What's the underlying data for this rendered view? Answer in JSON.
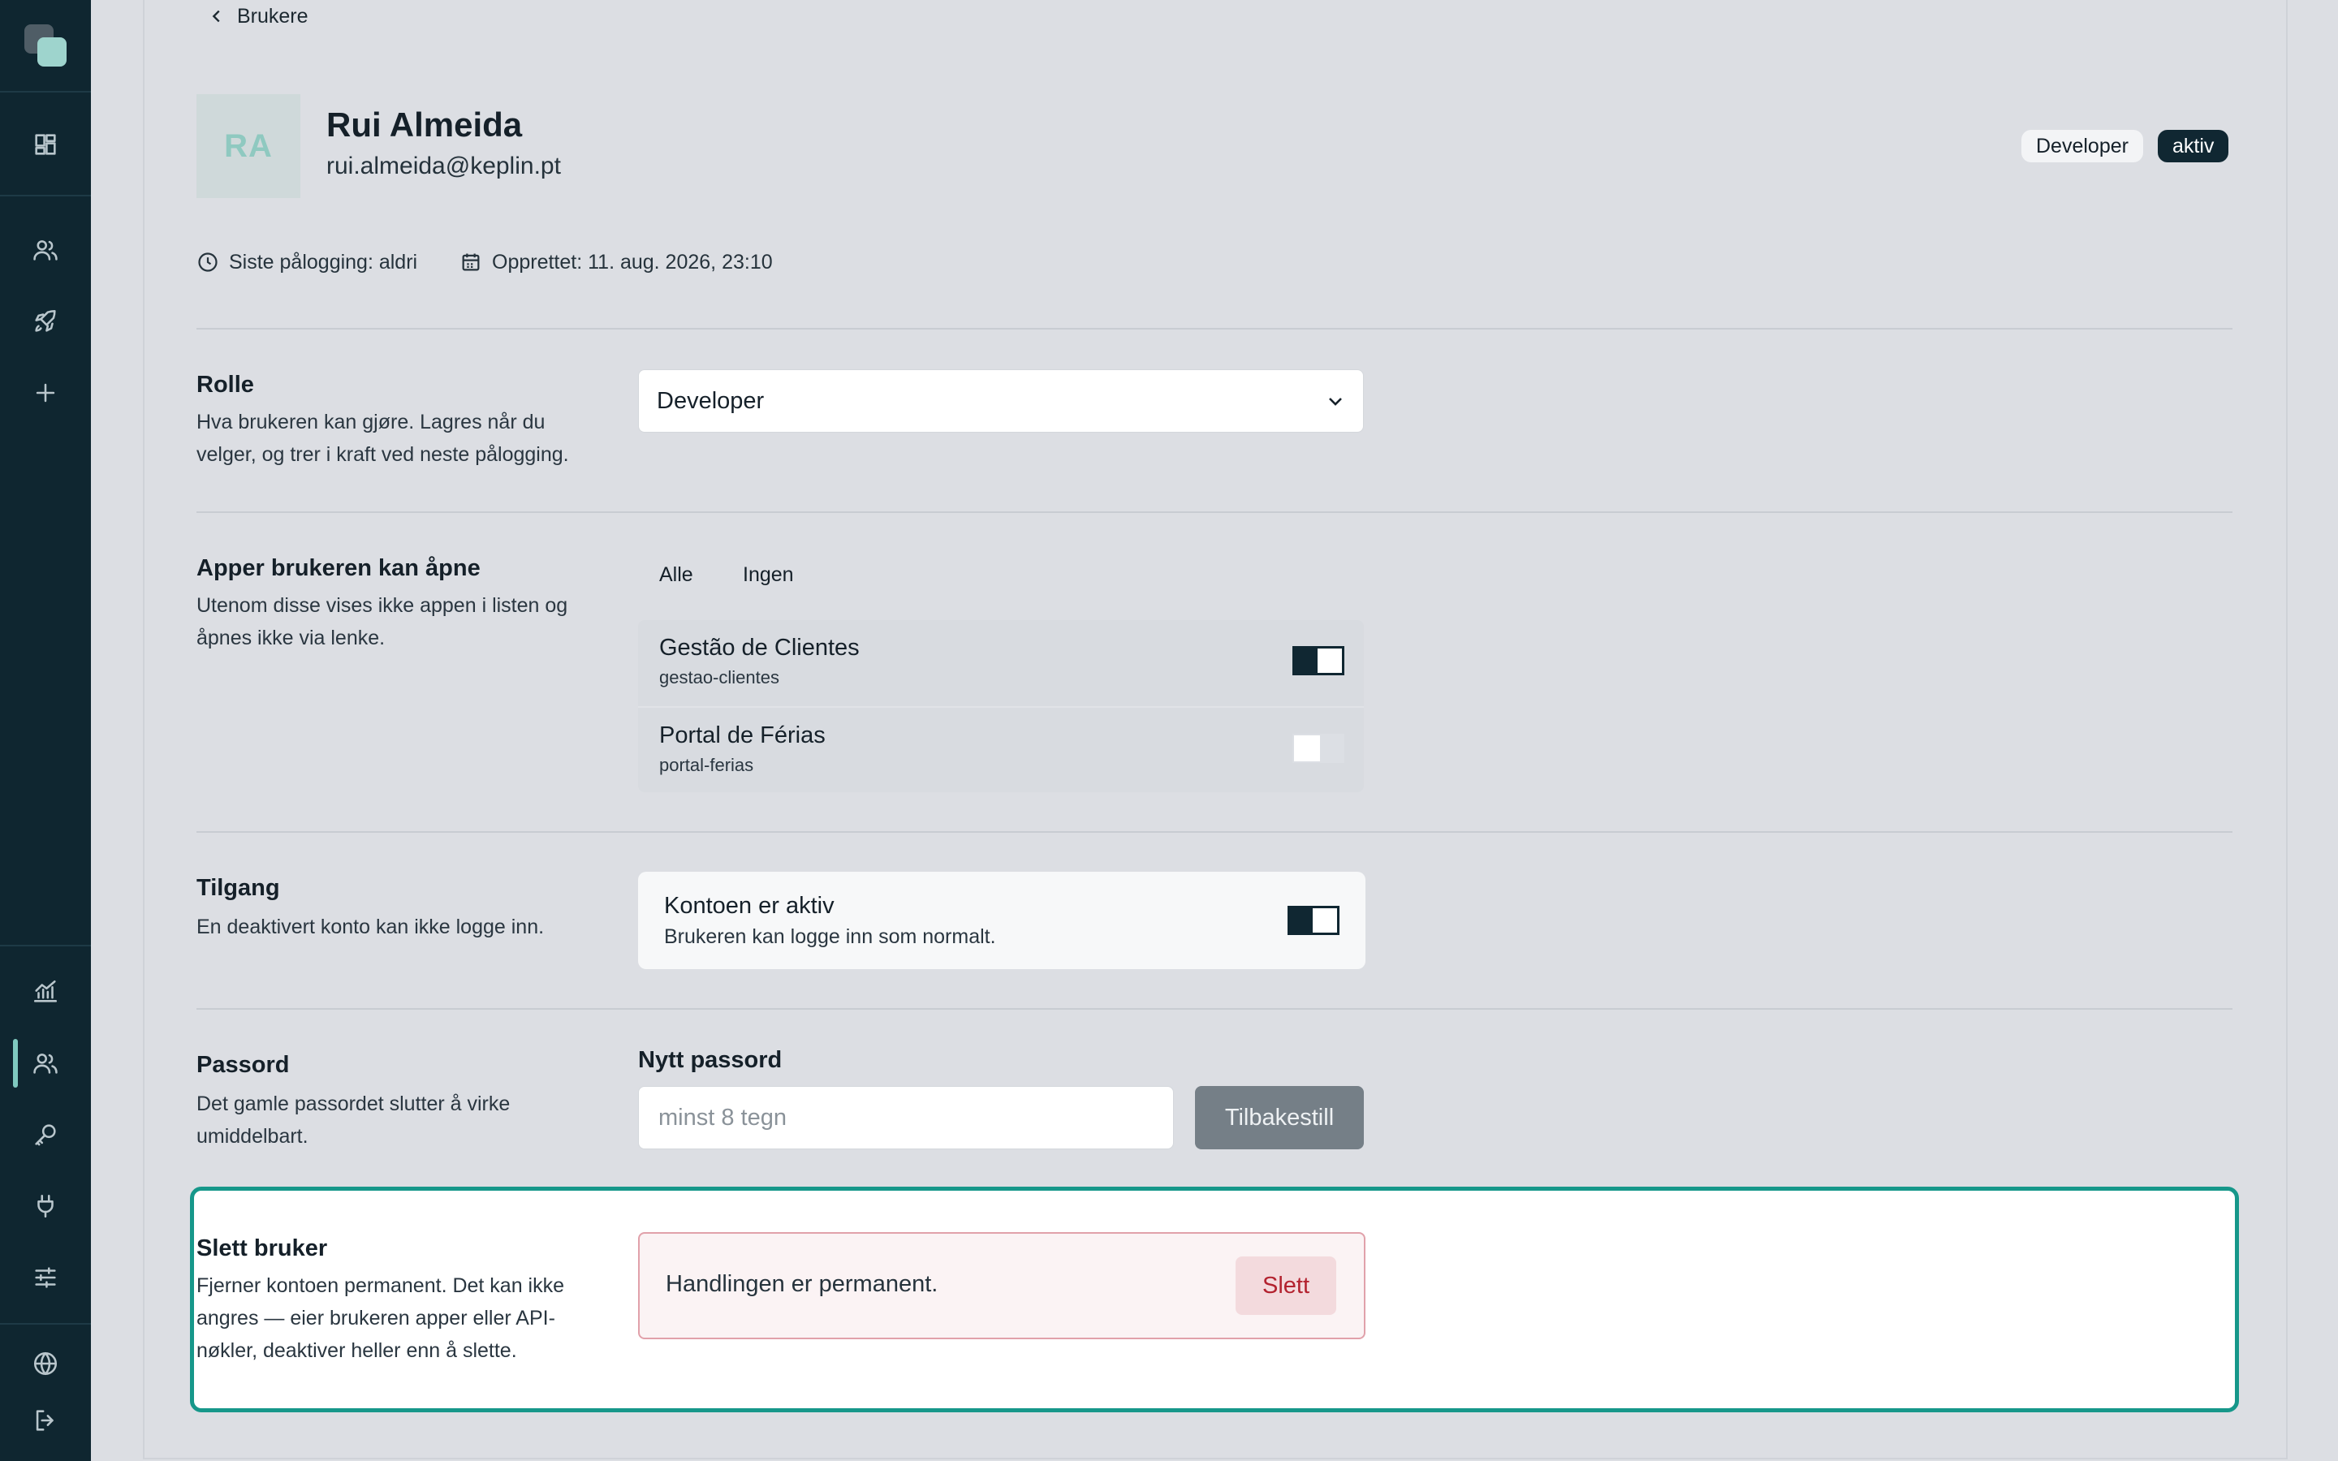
{
  "nav": {
    "back_label": "Brukere"
  },
  "user": {
    "initials": "RA",
    "name": "Rui Almeida",
    "email": "rui.almeida@keplin.pt",
    "role_badge": "Developer",
    "status_badge": "aktiv",
    "last_login": "Siste pålogging: aldri",
    "created": "Opprettet: 11. aug. 2026, 23:10"
  },
  "role_section": {
    "title": "Rolle",
    "description": "Hva brukeren kan gjøre. Lagres når du velger, og trer i kraft ved neste pålogging.",
    "selected": "Developer"
  },
  "apps_section": {
    "title": "Apper brukeren kan åpne",
    "description": "Utenom disse vises ikke appen i listen og åpnes ikke via lenke.",
    "all_label": "Alle",
    "none_label": "Ingen",
    "apps": [
      {
        "name": "Gestão de Clientes",
        "slug": "gestao-clientes",
        "enabled": true
      },
      {
        "name": "Portal de Férias",
        "slug": "portal-ferias",
        "enabled": false
      }
    ]
  },
  "access_section": {
    "title": "Tilgang",
    "description": "En deaktivert konto kan ikke logge inn.",
    "card_title": "Kontoen er aktiv",
    "card_subtitle": "Brukeren kan logge inn som normalt.",
    "active": true
  },
  "password_section": {
    "title": "Passord",
    "description": "Det gamle passordet slutter å virke umiddelbart.",
    "field_label": "Nytt passord",
    "placeholder": "minst 8 tegn",
    "value": "",
    "reset_label": "Tilbakestill"
  },
  "delete_section": {
    "title": "Slett bruker",
    "description": "Fjerner kontoen permanent. Det kan ikke angres — eier brukeren apper eller API-nøkler, deaktiver heller enn å slette.",
    "warning": "Handlingen er permanent.",
    "delete_label": "Slett"
  },
  "colors": {
    "sidebar": "#0f2630",
    "accent": "#16978a",
    "danger": "#b3222f",
    "dark": "#102732"
  }
}
